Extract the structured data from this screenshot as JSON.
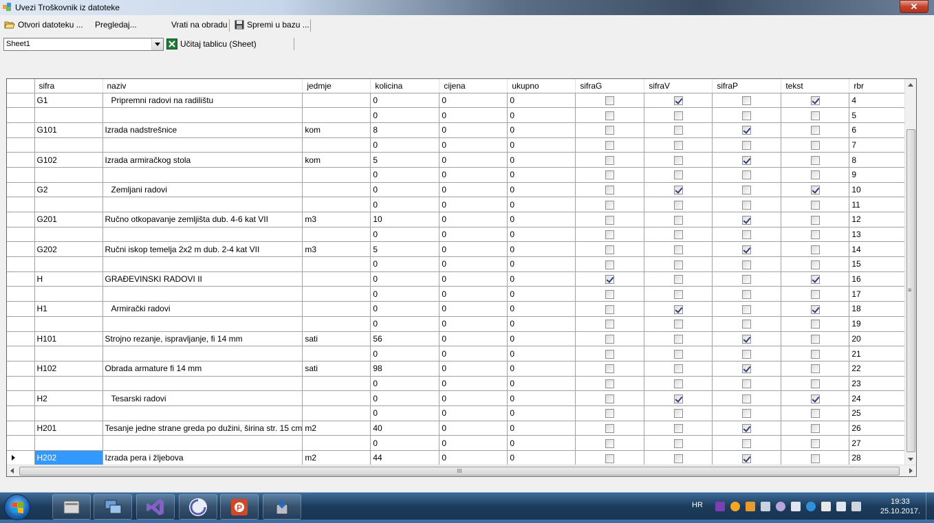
{
  "window": {
    "title": "Uvezi Troškovnik iz datoteke",
    "close_label": "✕"
  },
  "toolbar": {
    "open_label": "Otvori datoteku ...",
    "preview_label": "Pregledaj...",
    "return_label": "Vrati na obradu",
    "save_label": "Spremi u bazu ..."
  },
  "toolbar2": {
    "sheet_selected": "Sheet1",
    "load_label": "Učitaj tablicu (Sheet)"
  },
  "grid": {
    "columns": [
      "sifra",
      "naziv",
      "jedmje",
      "kolicina",
      "cijena",
      "ukupno",
      "sifraG",
      "sifraV",
      "sifraP",
      "tekst",
      "rbr"
    ],
    "rows": [
      {
        "sifra": "G1",
        "naziv": "Pripremni radovi na radilištu",
        "indent": true,
        "jedmje": "",
        "kolicina": "0",
        "cijena": "0",
        "ukupno": "0",
        "sifraG": false,
        "sifraV": true,
        "sifraP": false,
        "tekst": true,
        "rbr": "4"
      },
      {
        "sifra": "",
        "naziv": "",
        "indent": false,
        "jedmje": "",
        "kolicina": "0",
        "cijena": "0",
        "ukupno": "0",
        "sifraG": false,
        "sifraV": false,
        "sifraP": false,
        "tekst": false,
        "rbr": "5"
      },
      {
        "sifra": "G101",
        "naziv": "Izrada nadstrešnice",
        "indent": false,
        "jedmje": "kom",
        "kolicina": "8",
        "cijena": "0",
        "ukupno": "0",
        "sifraG": false,
        "sifraV": false,
        "sifraP": true,
        "tekst": false,
        "rbr": "6"
      },
      {
        "sifra": "",
        "naziv": "",
        "indent": false,
        "jedmje": "",
        "kolicina": "0",
        "cijena": "0",
        "ukupno": "0",
        "sifraG": false,
        "sifraV": false,
        "sifraP": false,
        "tekst": false,
        "rbr": "7"
      },
      {
        "sifra": "G102",
        "naziv": "Izrada armiračkog stola",
        "indent": false,
        "jedmje": "kom",
        "kolicina": "5",
        "cijena": "0",
        "ukupno": "0",
        "sifraG": false,
        "sifraV": false,
        "sifraP": true,
        "tekst": false,
        "rbr": "8"
      },
      {
        "sifra": "",
        "naziv": "",
        "indent": false,
        "jedmje": "",
        "kolicina": "0",
        "cijena": "0",
        "ukupno": "0",
        "sifraG": false,
        "sifraV": false,
        "sifraP": false,
        "tekst": false,
        "rbr": "9"
      },
      {
        "sifra": "G2",
        "naziv": "Zemljani radovi",
        "indent": true,
        "jedmje": "",
        "kolicina": "0",
        "cijena": "0",
        "ukupno": "0",
        "sifraG": false,
        "sifraV": true,
        "sifraP": false,
        "tekst": true,
        "rbr": "10"
      },
      {
        "sifra": "",
        "naziv": "",
        "indent": false,
        "jedmje": "",
        "kolicina": "0",
        "cijena": "0",
        "ukupno": "0",
        "sifraG": false,
        "sifraV": false,
        "sifraP": false,
        "tekst": false,
        "rbr": "11"
      },
      {
        "sifra": "G201",
        "naziv": "Ručno otkopavanje zemljišta dub. 4-6 kat VII",
        "indent": false,
        "jedmje": "m3",
        "kolicina": "10",
        "cijena": "0",
        "ukupno": "0",
        "sifraG": false,
        "sifraV": false,
        "sifraP": true,
        "tekst": false,
        "rbr": "12"
      },
      {
        "sifra": "",
        "naziv": "",
        "indent": false,
        "jedmje": "",
        "kolicina": "0",
        "cijena": "0",
        "ukupno": "0",
        "sifraG": false,
        "sifraV": false,
        "sifraP": false,
        "tekst": false,
        "rbr": "13"
      },
      {
        "sifra": "G202",
        "naziv": "Ručni iskop temelja 2x2 m dub. 2-4 kat VII",
        "indent": false,
        "jedmje": "m3",
        "kolicina": "5",
        "cijena": "0",
        "ukupno": "0",
        "sifraG": false,
        "sifraV": false,
        "sifraP": true,
        "tekst": false,
        "rbr": "14"
      },
      {
        "sifra": "",
        "naziv": "",
        "indent": false,
        "jedmje": "",
        "kolicina": "0",
        "cijena": "0",
        "ukupno": "0",
        "sifraG": false,
        "sifraV": false,
        "sifraP": false,
        "tekst": false,
        "rbr": "15"
      },
      {
        "sifra": "H",
        "naziv": "GRAĐEVINSKI RADOVI II",
        "indent": false,
        "jedmje": "",
        "kolicina": "0",
        "cijena": "0",
        "ukupno": "0",
        "sifraG": true,
        "sifraV": false,
        "sifraP": false,
        "tekst": true,
        "rbr": "16"
      },
      {
        "sifra": "",
        "naziv": "",
        "indent": false,
        "jedmje": "",
        "kolicina": "0",
        "cijena": "0",
        "ukupno": "0",
        "sifraG": false,
        "sifraV": false,
        "sifraP": false,
        "tekst": false,
        "rbr": "17"
      },
      {
        "sifra": "H1",
        "naziv": "Armirački radovi",
        "indent": true,
        "jedmje": "",
        "kolicina": "0",
        "cijena": "0",
        "ukupno": "0",
        "sifraG": false,
        "sifraV": true,
        "sifraP": false,
        "tekst": true,
        "rbr": "18"
      },
      {
        "sifra": "",
        "naziv": "",
        "indent": false,
        "jedmje": "",
        "kolicina": "0",
        "cijena": "0",
        "ukupno": "0",
        "sifraG": false,
        "sifraV": false,
        "sifraP": false,
        "tekst": false,
        "rbr": "19"
      },
      {
        "sifra": "H101",
        "naziv": "Strojno rezanje, ispravljanje, fi 14 mm",
        "indent": false,
        "jedmje": "sati",
        "kolicina": "56",
        "cijena": "0",
        "ukupno": "0",
        "sifraG": false,
        "sifraV": false,
        "sifraP": true,
        "tekst": false,
        "rbr": "20"
      },
      {
        "sifra": "",
        "naziv": "",
        "indent": false,
        "jedmje": "",
        "kolicina": "0",
        "cijena": "0",
        "ukupno": "0",
        "sifraG": false,
        "sifraV": false,
        "sifraP": false,
        "tekst": false,
        "rbr": "21"
      },
      {
        "sifra": "H102",
        "naziv": "Obrada armature fi 14 mm",
        "indent": false,
        "jedmje": "sati",
        "kolicina": "98",
        "cijena": "0",
        "ukupno": "0",
        "sifraG": false,
        "sifraV": false,
        "sifraP": true,
        "tekst": false,
        "rbr": "22"
      },
      {
        "sifra": "",
        "naziv": "",
        "indent": false,
        "jedmje": "",
        "kolicina": "0",
        "cijena": "0",
        "ukupno": "0",
        "sifraG": false,
        "sifraV": false,
        "sifraP": false,
        "tekst": false,
        "rbr": "23"
      },
      {
        "sifra": "H2",
        "naziv": "Tesarski radovi",
        "indent": true,
        "jedmje": "",
        "kolicina": "0",
        "cijena": "0",
        "ukupno": "0",
        "sifraG": false,
        "sifraV": true,
        "sifraP": false,
        "tekst": true,
        "rbr": "24"
      },
      {
        "sifra": "",
        "naziv": "",
        "indent": false,
        "jedmje": "",
        "kolicina": "0",
        "cijena": "0",
        "ukupno": "0",
        "sifraG": false,
        "sifraV": false,
        "sifraP": false,
        "tekst": false,
        "rbr": "25"
      },
      {
        "sifra": "H201",
        "naziv": "Tesanje jedne strane greda po dužini, širina str. 15 cm",
        "indent": false,
        "jedmje": "m2",
        "kolicina": "40",
        "cijena": "0",
        "ukupno": "0",
        "sifraG": false,
        "sifraV": false,
        "sifraP": true,
        "tekst": false,
        "rbr": "26"
      },
      {
        "sifra": "",
        "naziv": "",
        "indent": false,
        "jedmje": "",
        "kolicina": "0",
        "cijena": "0",
        "ukupno": "0",
        "sifraG": false,
        "sifraV": false,
        "sifraP": false,
        "tekst": false,
        "rbr": "27"
      },
      {
        "sifra": "H202",
        "naziv": "Izrada pera i žljebova",
        "indent": false,
        "jedmje": "m2",
        "kolicina": "44",
        "cijena": "0",
        "ukupno": "0",
        "sifraG": false,
        "sifraV": false,
        "sifraP": true,
        "tekst": false,
        "rbr": "28",
        "current": true
      }
    ]
  },
  "hscroll_grip": "III",
  "vscroll_grip": "≡",
  "taskbar": {
    "apps": [
      "file-manager-icon",
      "network-icon",
      "visual-studio-icon",
      "media-icon",
      "powerpoint-icon",
      "installer-icon"
    ],
    "tray_lang": "HR",
    "clock_time": "19:33",
    "clock_date": "25.10.2017."
  },
  "colors": {
    "selection": "#3399ff",
    "taskbar": "#1d3c5d"
  }
}
